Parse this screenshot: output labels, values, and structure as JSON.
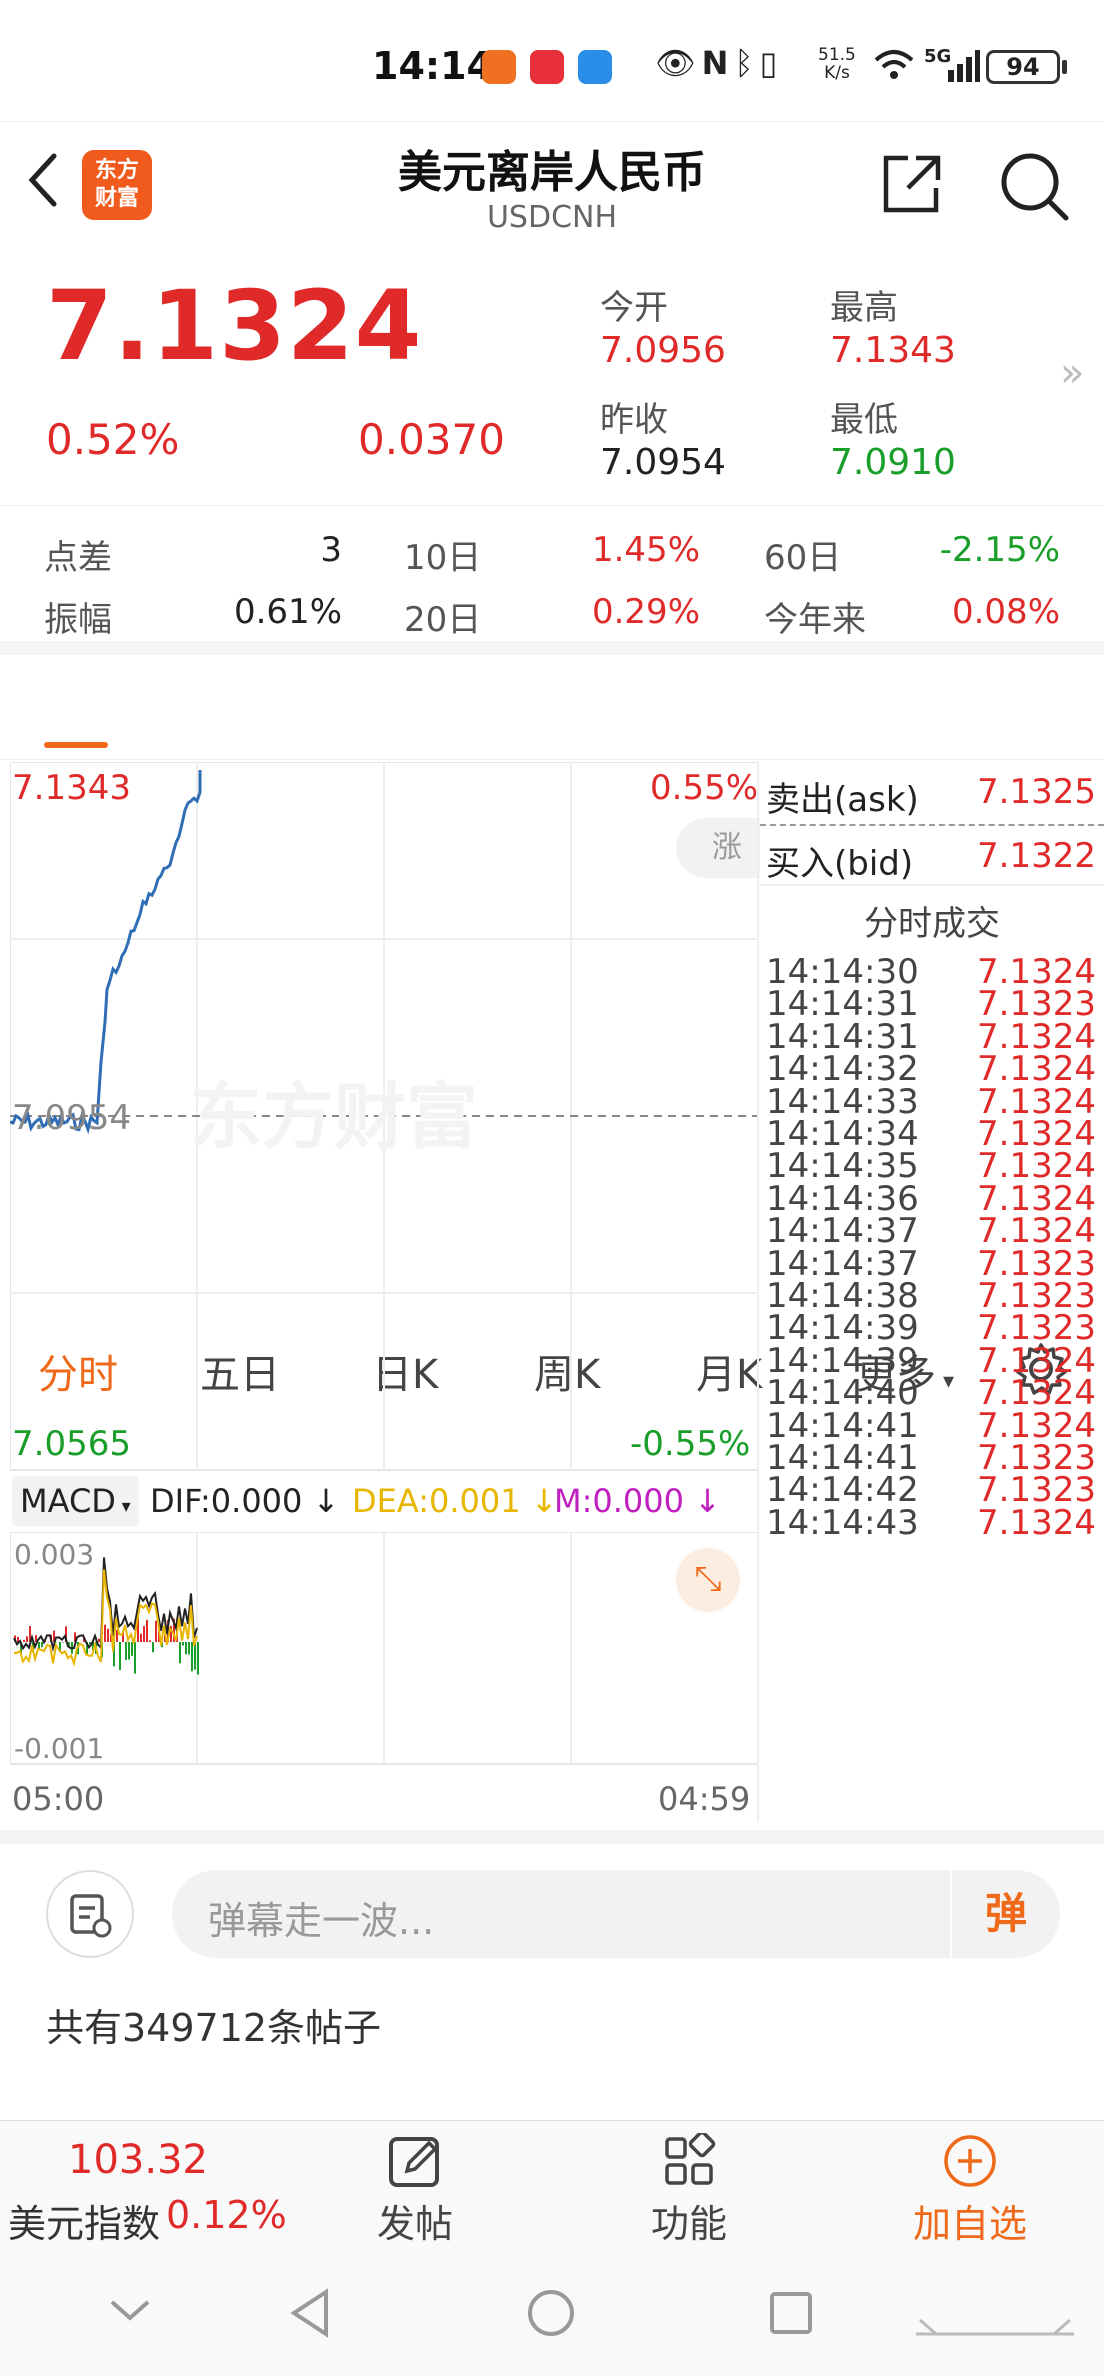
{
  "status_bar": {
    "time": "14:14",
    "net_speed_value": "51.5",
    "net_speed_unit": "K/s",
    "network": "5G",
    "battery": "94",
    "icons": [
      "eye-icon",
      "nfc-icon",
      "bluetooth-icon",
      "vibrate-icon",
      "wifi-icon",
      "signal-icon"
    ]
  },
  "header": {
    "title": "美元离岸人民币",
    "subtitle": "USDCNH",
    "logo_line1": "东方",
    "logo_line2": "财富"
  },
  "quote": {
    "price": "7.1324",
    "change_pct": "0.52%",
    "change": "0.0370",
    "open_label": "今开",
    "open": "7.0956",
    "high_label": "最高",
    "high": "7.1343",
    "prev_close_label": "昨收",
    "prev_close": "7.0954",
    "low_label": "最低",
    "low": "7.0910"
  },
  "stats": {
    "spread_label": "点差",
    "spread": "3",
    "d10_label": "10日",
    "d10": "1.45%",
    "d60_label": "60日",
    "d60": "-2.15%",
    "amplitude_label": "振幅",
    "amplitude": "0.61%",
    "d20_label": "20日",
    "d20": "0.29%",
    "ytd_label": "今年来",
    "ytd": "0.08%"
  },
  "tabs": [
    "分时",
    "五日",
    "日K",
    "周K",
    "月K",
    "更多"
  ],
  "active_tab": "分时",
  "chart": {
    "top_price": "7.1343",
    "top_pct": "0.55%",
    "mid_price": "7.0954",
    "bottom_price": "7.0565",
    "bottom_pct": "-0.55%",
    "side_tag": "涨",
    "watermark": "东方财富",
    "time_start": "05:00",
    "time_end": "04:59"
  },
  "macd": {
    "selector": "MACD",
    "dif": "DIF:0.000",
    "dea": "DEA:0.001",
    "m": "M:0.000",
    "top_label": "0.003",
    "bottom_label": "-0.001",
    "colors": {
      "dif": "#222222",
      "dea": "#e8b500",
      "m": "#c020c0"
    }
  },
  "book": {
    "ask_label": "卖出(ask)",
    "ask": "7.1325",
    "bid_label": "买入(bid)",
    "bid": "7.1322",
    "trades_title": "分时成交",
    "trades": [
      {
        "time": "14:14:30",
        "price": "7.1324"
      },
      {
        "time": "14:14:31",
        "price": "7.1323"
      },
      {
        "time": "14:14:31",
        "price": "7.1324"
      },
      {
        "time": "14:14:32",
        "price": "7.1324"
      },
      {
        "time": "14:14:33",
        "price": "7.1324"
      },
      {
        "time": "14:14:34",
        "price": "7.1324"
      },
      {
        "time": "14:14:35",
        "price": "7.1324"
      },
      {
        "time": "14:14:36",
        "price": "7.1324"
      },
      {
        "time": "14:14:37",
        "price": "7.1324"
      },
      {
        "time": "14:14:37",
        "price": "7.1323"
      },
      {
        "time": "14:14:38",
        "price": "7.1323"
      },
      {
        "time": "14:14:39",
        "price": "7.1323"
      },
      {
        "time": "14:14:39",
        "price": "7.1324"
      },
      {
        "time": "14:14:40",
        "price": "7.1324"
      },
      {
        "time": "14:14:41",
        "price": "7.1324"
      },
      {
        "time": "14:14:41",
        "price": "7.1323"
      },
      {
        "time": "14:14:42",
        "price": "7.1323"
      },
      {
        "time": "14:14:43",
        "price": "7.1324"
      }
    ]
  },
  "danmu": {
    "placeholder": "弹幕走一波...",
    "send_label": "弹"
  },
  "posts": {
    "count_text": "共有349712条帖子"
  },
  "bottom_nav": {
    "index_value": "103.32",
    "index_label": "美元指数",
    "index_pct": "0.12%",
    "post_label": "发帖",
    "func_label": "功能",
    "add_label": "加自选"
  },
  "colors": {
    "up": "#e02a2a",
    "down": "#1a9e2a",
    "accent": "#ee6a1a",
    "price_line": "#2f6db5"
  }
}
